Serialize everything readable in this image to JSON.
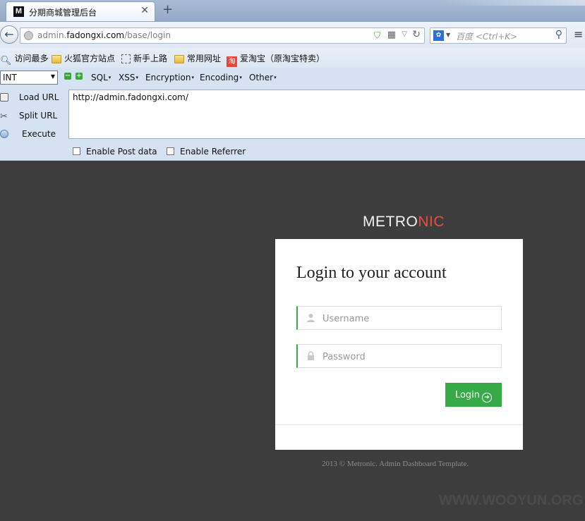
{
  "tab": {
    "favicon": "M",
    "title": "分期商城管理后台",
    "close": "✕",
    "new_tab": "+"
  },
  "nav": {
    "back_icon": "←",
    "url_prefix": "admin.",
    "url_domain": "fadongxi.com",
    "url_path": "/base/login",
    "search_engine_icon": "paw-icon",
    "search_placeholder": "百度 <Ctrl+K>"
  },
  "bookmarks": [
    {
      "label": "访问最多",
      "icon": "magnifier-icon"
    },
    {
      "label": "火狐官方站点",
      "icon": "folder-icon"
    },
    {
      "label": "新手上路",
      "icon": "dotted-page-icon"
    },
    {
      "label": "常用网址",
      "icon": "folder-icon"
    },
    {
      "label": "爱淘宝（原淘宝特卖）",
      "icon": "taobao-icon"
    }
  ],
  "hackbar": {
    "select_value": "INT",
    "menus": [
      "SQL",
      "XSS",
      "Encryption",
      "Encoding",
      "Other"
    ],
    "load_url": "Load URL",
    "split_url": "Split URL",
    "execute": "Execute",
    "url_text": "http://admin.fadongxi.com/",
    "enable_post": "Enable Post data",
    "enable_referrer": "Enable Referrer"
  },
  "page": {
    "logo_part1": "METRO",
    "logo_part2": "NIC",
    "heading": "Login to your account",
    "username_placeholder": "Username",
    "password_placeholder": "Password",
    "login_label": "Login",
    "copyright": "2013 © Metronic. Admin Dashboard Template.",
    "watermark": "WWW.WOOYUN.ORG"
  },
  "colors": {
    "accent_green": "#35aa47",
    "logo_red": "#e84e40",
    "page_bg": "#3d3d3d"
  }
}
